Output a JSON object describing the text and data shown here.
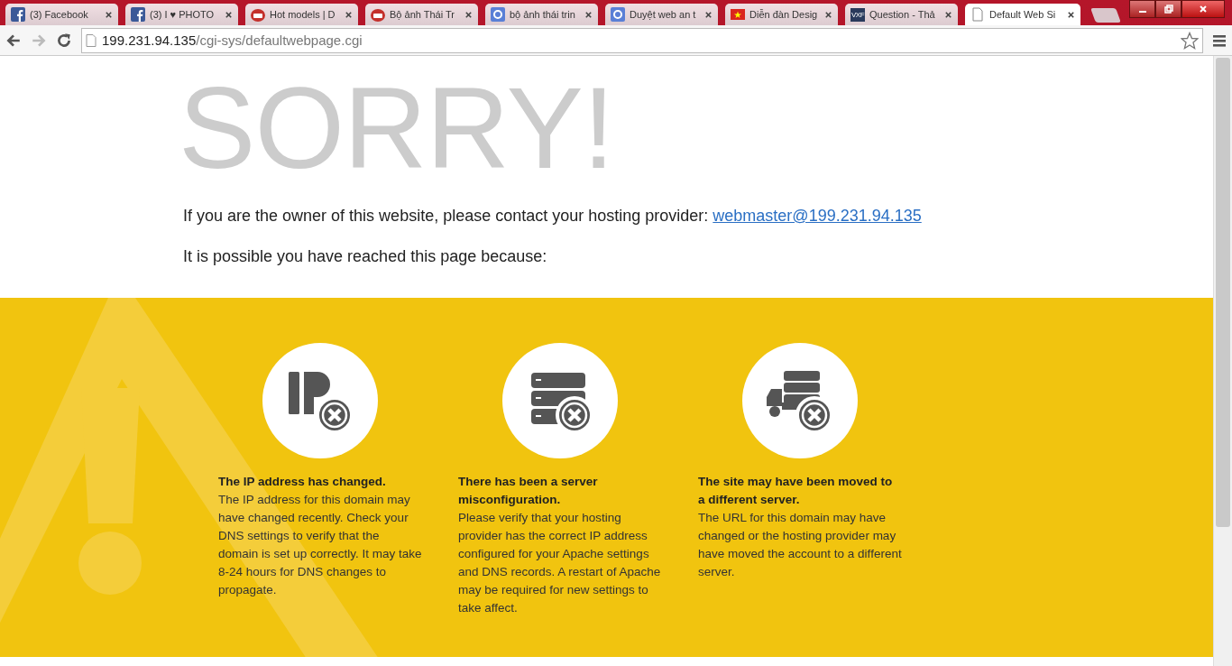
{
  "tabs": [
    {
      "title": "(3) Facebook",
      "kind": "facebook",
      "selected": false
    },
    {
      "title": "(3) I ♥ PHOTO",
      "kind": "facebook",
      "selected": false
    },
    {
      "title": "Hot models | D",
      "kind": "youtube",
      "selected": false
    },
    {
      "title": "Bộ ảnh Thái Tr",
      "kind": "youtube",
      "selected": false
    },
    {
      "title": "bộ ảnh thái trin",
      "kind": "google",
      "selected": false
    },
    {
      "title": "Duyệt web an t",
      "kind": "google",
      "selected": false
    },
    {
      "title": "Diễn đàn Desig",
      "kind": "flag",
      "selected": false
    },
    {
      "title": "Question - Thả",
      "kind": "vxf",
      "icon_text": "VXF",
      "selected": false
    },
    {
      "title": "Default Web Si",
      "kind": "page",
      "selected": true
    }
  ],
  "address": {
    "host": "199.231.94.135",
    "path": "/cgi-sys/defaultwebpage.cgi"
  },
  "page": {
    "heading": "SORRY!",
    "owner_text": "If you are the owner of this website, please contact your hosting provider:",
    "owner_link": "webmaster@199.231.94.135",
    "reason_intro": "It is possible you have reached this page because:",
    "reasons": [
      {
        "kind": "ip",
        "title": "The IP address has changed.",
        "body": "The IP address for this domain may have changed recently. Check your DNS settings to verify that the domain is set up correctly. It may take 8-24 hours for DNS changes to propagate."
      },
      {
        "kind": "server",
        "title": "There has been a server misconfiguration.",
        "body": "Please verify that your hosting provider has the correct IP address configured for your Apache settings and DNS records. A restart of Apache may be required for new settings to take affect."
      },
      {
        "kind": "truck",
        "title": "The site may have been moved to a different server.",
        "body": "The URL for this domain may have changed or the hosting provider may have moved the account to a different server."
      }
    ]
  }
}
